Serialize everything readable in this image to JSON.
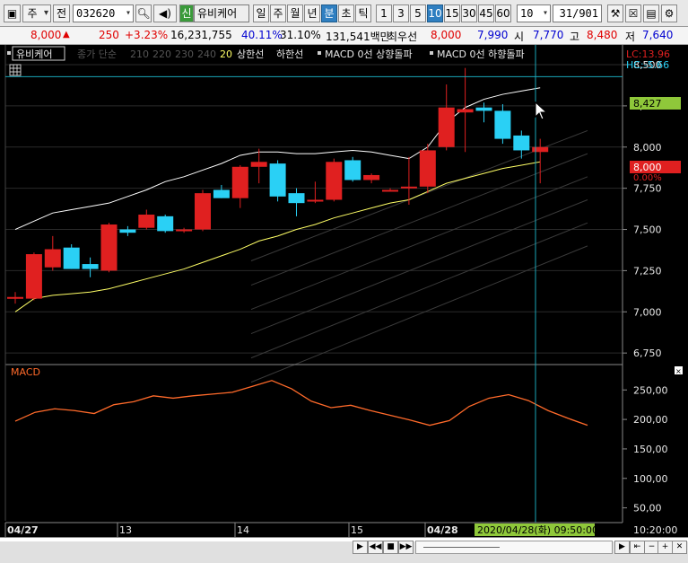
{
  "toolbar": {
    "mode_label": "주",
    "market_label": "전",
    "code_value": "032620",
    "badge_label": "신",
    "stock_name": "유비케어",
    "period_tabs": [
      "일",
      "주",
      "월",
      "년",
      "분",
      "초",
      "틱"
    ],
    "active_period": "분",
    "interval_buttons": [
      "1",
      "3",
      "5",
      "10",
      "15",
      "30",
      "45",
      "60"
    ],
    "active_interval": "10",
    "count_value": "10",
    "page_value": "31",
    "page_total": "/901"
  },
  "quote": {
    "price": "8,000",
    "change_arrow": "▲",
    "change": "250",
    "change_pct": "+3.23%",
    "volume": "16,231,755",
    "ratio1": "40.11%",
    "ratio2": "31.10%",
    "amount": "131,541백만",
    "order_label": "최우선",
    "ask": "8,000",
    "bid": "7,990",
    "open_label": "시",
    "open": "7,770",
    "high_label": "고",
    "high": "8,480",
    "low_label": "저",
    "low": "7,640"
  },
  "legend": {
    "name": "유비케어",
    "ma_label": "종가 단순",
    "ma_periods": [
      "210",
      "220",
      "230",
      "240"
    ],
    "ma_20": "20",
    "upper_label": "상한선",
    "lower_label": "하한선",
    "macd_up": "MACD 0선 상향돌파",
    "macd_down": "MACD 0선 하향돌파",
    "lc": "LC:13.96",
    "hc": "HC:-5.66"
  },
  "price_panel": {
    "crosshair_value": "8,427",
    "last_price": "8,000",
    "last_pct": "0.00%"
  },
  "macd_panel": {
    "title": "MACD"
  },
  "x_axis": {
    "labels": [
      "04/27",
      "13",
      "14",
      "15",
      "04/28"
    ],
    "cursor_label": "2020/04/28(화) 09:50:00",
    "time_label": "10:20:00"
  },
  "colors": {
    "up": "#e02020",
    "down": "#2ad0f5",
    "ma20": "#ffff66",
    "bollinger": "#ffffff",
    "macd": "#ff6a2a",
    "crosshair": "#1aa6b8",
    "grid": "#2a2a2a"
  },
  "chart_data": [
    {
      "type": "candlestick",
      "title": "",
      "ylim": [
        6.68,
        8.62
      ],
      "y_ticks": [
        "8,500",
        "8,250",
        "8,000",
        "7,750",
        "7,500",
        "7,250",
        "7,000",
        "6,750"
      ],
      "y_tick_values": [
        8.5,
        8.25,
        8.0,
        7.75,
        7.5,
        7.25,
        7.0,
        6.75
      ],
      "candles": [
        {
          "o": 7.08,
          "h": 7.12,
          "l": 7.05,
          "c": 7.09
        },
        {
          "o": 7.08,
          "h": 7.36,
          "l": 7.07,
          "c": 7.35
        },
        {
          "o": 7.27,
          "h": 7.46,
          "l": 7.25,
          "c": 7.38
        },
        {
          "o": 7.39,
          "h": 7.41,
          "l": 7.26,
          "c": 7.26
        },
        {
          "o": 7.29,
          "h": 7.33,
          "l": 7.21,
          "c": 7.26
        },
        {
          "o": 7.25,
          "h": 7.54,
          "l": 7.24,
          "c": 7.53
        },
        {
          "o": 7.5,
          "h": 7.52,
          "l": 7.46,
          "c": 7.48
        },
        {
          "o": 7.51,
          "h": 7.62,
          "l": 7.5,
          "c": 7.59
        },
        {
          "o": 7.58,
          "h": 7.59,
          "l": 7.48,
          "c": 7.49
        },
        {
          "o": 7.49,
          "h": 7.51,
          "l": 7.48,
          "c": 7.5
        },
        {
          "o": 7.5,
          "h": 7.74,
          "l": 7.49,
          "c": 7.72
        },
        {
          "o": 7.74,
          "h": 7.77,
          "l": 7.69,
          "c": 7.69
        },
        {
          "o": 7.69,
          "h": 7.89,
          "l": 7.63,
          "c": 7.88
        },
        {
          "o": 7.88,
          "h": 7.99,
          "l": 7.78,
          "c": 7.91
        },
        {
          "o": 7.9,
          "h": 7.92,
          "l": 7.67,
          "c": 7.7
        },
        {
          "o": 7.72,
          "h": 7.75,
          "l": 7.58,
          "c": 7.66
        },
        {
          "o": 7.67,
          "h": 7.79,
          "l": 7.66,
          "c": 7.68
        },
        {
          "o": 7.68,
          "h": 7.93,
          "l": 7.67,
          "c": 7.91
        },
        {
          "o": 7.92,
          "h": 7.94,
          "l": 7.79,
          "c": 7.8
        },
        {
          "o": 7.8,
          "h": 7.84,
          "l": 7.78,
          "c": 7.83
        },
        {
          "o": 7.74,
          "h": 7.75,
          "l": 7.73,
          "c": 7.74
        },
        {
          "o": 7.76,
          "h": 7.94,
          "l": 7.65,
          "c": 7.76
        },
        {
          "o": 7.76,
          "h": 8.02,
          "l": 7.72,
          "c": 7.98
        },
        {
          "o": 8.0,
          "h": 8.38,
          "l": 7.98,
          "c": 8.24
        },
        {
          "o": 8.21,
          "h": 8.48,
          "l": 7.97,
          "c": 8.23
        },
        {
          "o": 8.24,
          "h": 8.27,
          "l": 8.15,
          "c": 8.22
        },
        {
          "o": 8.22,
          "h": 8.26,
          "l": 8.02,
          "c": 8.05
        },
        {
          "o": 8.07,
          "h": 8.1,
          "l": 7.93,
          "c": 7.98
        },
        {
          "o": 7.97,
          "h": 8.05,
          "l": 7.78,
          "c": 8.0
        }
      ],
      "ma20": [
        7.0,
        7.08,
        7.1,
        7.11,
        7.12,
        7.14,
        7.17,
        7.2,
        7.23,
        7.26,
        7.3,
        7.34,
        7.38,
        7.43,
        7.46,
        7.5,
        7.53,
        7.57,
        7.6,
        7.63,
        7.66,
        7.68,
        7.73,
        7.78,
        7.81,
        7.84,
        7.87,
        7.89,
        7.91
      ],
      "bollinger_upper": [
        7.5,
        7.55,
        7.6,
        7.62,
        7.64,
        7.66,
        7.7,
        7.74,
        7.79,
        7.82,
        7.86,
        7.9,
        7.95,
        7.97,
        7.97,
        7.96,
        7.96,
        7.97,
        7.98,
        7.97,
        7.95,
        7.93,
        8.0,
        8.15,
        8.24,
        8.29,
        8.32,
        8.34,
        8.36
      ],
      "cursor_price": 8.427
    },
    {
      "type": "line",
      "title": "MACD",
      "ylim": [
        25,
        290
      ],
      "y_ticks": [
        "250,00",
        "200,00",
        "150,00",
        "100,00",
        "50,00"
      ],
      "y_tick_values": [
        250,
        200,
        150,
        100,
        50
      ],
      "series": [
        {
          "values": [
            197,
            212,
            218,
            215,
            210,
            225,
            230,
            240,
            236,
            240,
            243,
            246,
            256,
            266,
            252,
            231,
            220,
            224,
            215,
            207,
            199,
            190,
            198,
            222,
            236,
            242,
            232,
            215,
            202,
            190
          ]
        }
      ]
    }
  ]
}
